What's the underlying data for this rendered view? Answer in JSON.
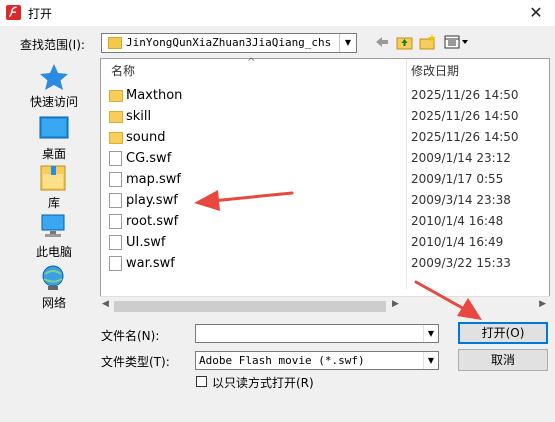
{
  "window": {
    "title": "打开",
    "close": "✕"
  },
  "lookin": {
    "label": "查找范围(I):",
    "value": "JinYongQunXiaZhuan3JiaQiang_chs"
  },
  "places": [
    {
      "label": "快速访问"
    },
    {
      "label": "桌面"
    },
    {
      "label": "库"
    },
    {
      "label": "此电脑"
    },
    {
      "label": "网络"
    }
  ],
  "list": {
    "col_name": "名称",
    "col_date": "修改日期",
    "rows": [
      {
        "name": "Maxthon",
        "date": "2025/11/26 14:50",
        "type": "folder"
      },
      {
        "name": "skill",
        "date": "2025/11/26 14:50",
        "type": "folder"
      },
      {
        "name": "sound",
        "date": "2025/11/26 14:50",
        "type": "folder"
      },
      {
        "name": "CG.swf",
        "date": "2009/1/14 23:12",
        "type": "file"
      },
      {
        "name": "map.swf",
        "date": "2009/1/17 0:55",
        "type": "file"
      },
      {
        "name": "play.swf",
        "date": "2009/3/14 23:38",
        "type": "file"
      },
      {
        "name": "root.swf",
        "date": "2010/1/4 16:48",
        "type": "file"
      },
      {
        "name": "UI.swf",
        "date": "2010/1/4 16:49",
        "type": "file"
      },
      {
        "name": "war.swf",
        "date": "2009/3/22 15:33",
        "type": "file"
      }
    ]
  },
  "filename": {
    "label": "文件名(N):",
    "value": ""
  },
  "filetype": {
    "label": "文件类型(T):",
    "value": "Adobe Flash movie (*.swf)"
  },
  "readonly": {
    "label": "以只读方式打开(R)"
  },
  "buttons": {
    "open": "打开(O)",
    "cancel": "取消"
  },
  "colors": {
    "accent": "#0078d7",
    "arrow": "#e8483f",
    "folder": "#f7cd5b"
  }
}
